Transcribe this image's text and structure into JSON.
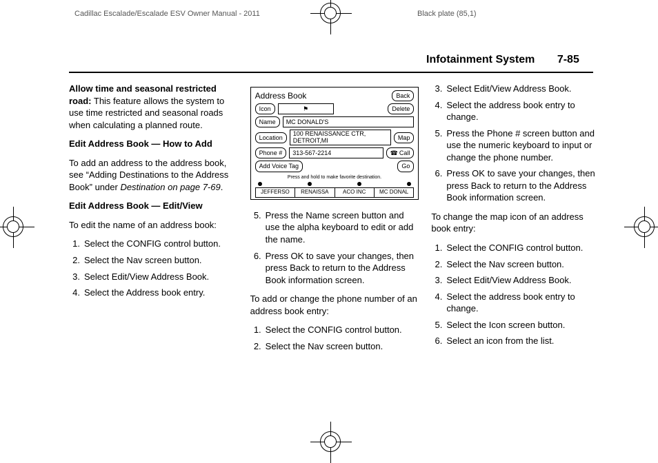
{
  "top": {
    "left": "Cadillac Escalade/Escalade ESV Owner Manual - 2011",
    "right": "Black plate (85,1)"
  },
  "header": {
    "section": "Infotainment System",
    "page": "7-85"
  },
  "col1": {
    "para1_bold": "Allow time and seasonal restricted road:",
    "para1_rest": "  This feature allows the system to use time restricted and seasonal roads when calculating a planned route.",
    "h1": "Edit Address Book — How to Add",
    "para2a": "To add an address to the address book, see “Adding Destinations to the Address Book” under ",
    "para2b_i": "Destination on page 7-69",
    "para2c": ".",
    "h2": "Edit Address Book — Edit/View",
    "para3": "To edit the name of an address book:",
    "list1": {
      "n1": "1.",
      "t1": "Select the CONFIG control button.",
      "n2": "2.",
      "t2": "Select the Nav screen button.",
      "n3": "3.",
      "t3": "Select Edit/View Address Book.",
      "n4": "4.",
      "t4": "Select the Address book entry."
    }
  },
  "figure": {
    "title": "Address Book",
    "back": "Back",
    "icon_lbl": "Icon",
    "icon_val": "⚑",
    "delete": "Delete",
    "name_lbl": "Name",
    "name_val": "MC DONALD'S",
    "loc_lbl": "Location",
    "loc_val": "100 RENAISSANCE CTR, DETROIT,MI",
    "map": "Map",
    "phone_lbl": "Phone #",
    "phone_val": "313-567-2214",
    "call": "Call",
    "voice_lbl": "Add Voice Tag",
    "go": "Go",
    "note": "Press and hold to make favorite destination.",
    "tabs": {
      "a": "JEFFERSO",
      "b": "RENAISSA",
      "c": "ACO INC",
      "d": "MC DONAL"
    }
  },
  "col2": {
    "list_a": {
      "n5": "5.",
      "t5": "Press the Name screen button and use the alpha keyboard to edit or add the name.",
      "n6": "6.",
      "t6": "Press OK to save your changes, then press Back to return to the Address Book information screen."
    },
    "para1": "To add or change the phone number of an address book entry:",
    "list_b": {
      "n1": "1.",
      "t1": "Select the CONFIG control button.",
      "n2": "2.",
      "t2": "Select the Nav screen button."
    }
  },
  "col3": {
    "list_a": {
      "n3": "3.",
      "t3": "Select Edit/View Address Book.",
      "n4": "4.",
      "t4": "Select the address book entry to change.",
      "n5": "5.",
      "t5": "Press the Phone # screen button and use the numeric keyboard to input or change the phone number.",
      "n6": "6.",
      "t6": "Press OK to save your changes, then press Back to return to the Address Book information screen."
    },
    "para1": "To change the map icon of an address book entry:",
    "list_b": {
      "n1": "1.",
      "t1": "Select the CONFIG control button.",
      "n2": "2.",
      "t2": "Select the Nav screen button.",
      "n3": "3.",
      "t3": "Select Edit/View Address Book.",
      "n4": "4.",
      "t4": "Select the address book entry to change.",
      "n5": "5.",
      "t5": "Select the Icon screen button.",
      "n6": "6.",
      "t6": "Select an icon from the list."
    }
  }
}
